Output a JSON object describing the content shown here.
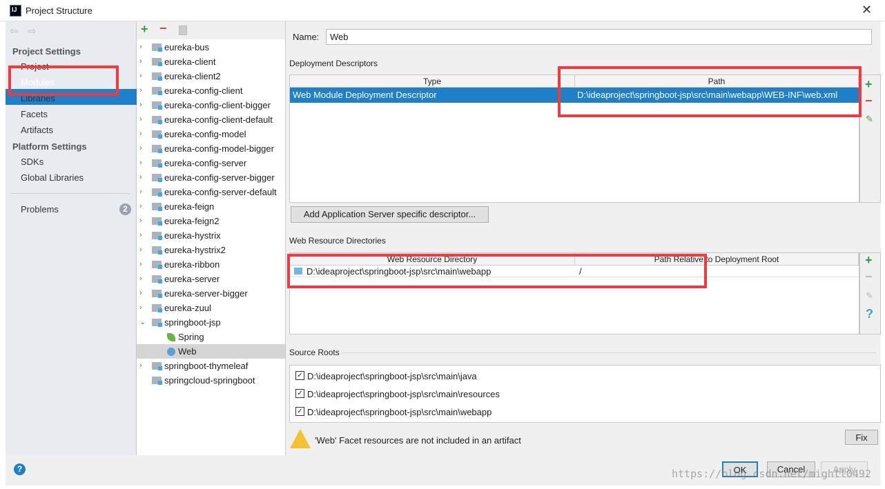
{
  "window": {
    "title": "Project Structure",
    "logo": "IJ",
    "close": "✕"
  },
  "sidebar": {
    "project_settings": "Project Settings",
    "items": [
      "Project",
      "Modules",
      "Libraries",
      "Facets",
      "Artifacts"
    ],
    "platform_settings": "Platform Settings",
    "platform_items": [
      "SDKs",
      "Global Libraries"
    ],
    "problems": "Problems",
    "problems_count": "2",
    "selected": "Modules"
  },
  "modules": [
    "eureka-bus",
    "eureka-client",
    "eureka-client2",
    "eureka-config-client",
    "eureka-config-client-bigger",
    "eureka-config-client-default",
    "eureka-config-model",
    "eureka-config-model-bigger",
    "eureka-config-server",
    "eureka-config-server-bigger",
    "eureka-config-server-default",
    "eureka-feign",
    "eureka-feign2",
    "eureka-hystrix",
    "eureka-hystrix2",
    "eureka-ribbon",
    "eureka-server",
    "eureka-server-bigger",
    "eureka-zuul",
    "springboot-jsp"
  ],
  "facets": [
    "Spring",
    "Web"
  ],
  "modules_after": [
    "springboot-thymeleaf",
    "springcloud-springboot"
  ],
  "detail": {
    "name_label": "Name:",
    "name_value": "Web",
    "deployment_descriptors": "Deployment Descriptors",
    "dd_columns": [
      "Type",
      "Path"
    ],
    "dd_row": [
      "Web Module Deployment Descriptor",
      "D:\\ideaproject\\springboot-jsp\\src\\main\\webapp\\WEB-INF\\web.xml"
    ],
    "add_server_button": "Add Application Server specific descriptor...",
    "web_resource_directories": "Web Resource Directories",
    "wr_columns": [
      "Web Resource Directory",
      "Path Relative to Deployment Root"
    ],
    "wr_row": [
      "D:\\ideaproject\\springboot-jsp\\src\\main\\webapp",
      "/"
    ],
    "source_roots": "Source Roots",
    "roots": [
      "D:\\ideaproject\\springboot-jsp\\src\\main\\java",
      "D:\\ideaproject\\springboot-jsp\\src\\main\\resources",
      "D:\\ideaproject\\springboot-jsp\\src\\main\\webapp"
    ],
    "warning": "'Web' Facet resources are not included in an artifact",
    "fix": "Fix"
  },
  "footer": {
    "help": "?",
    "ok": "OK",
    "cancel": "Cancel",
    "apply": "Apply",
    "watermark": "https://blog.csdn.net/mightl0492"
  },
  "colors": {
    "selection": "#1f7fc9",
    "highlight_box": "#f03a3e",
    "add": "#2ea043",
    "remove": "#e04040"
  }
}
